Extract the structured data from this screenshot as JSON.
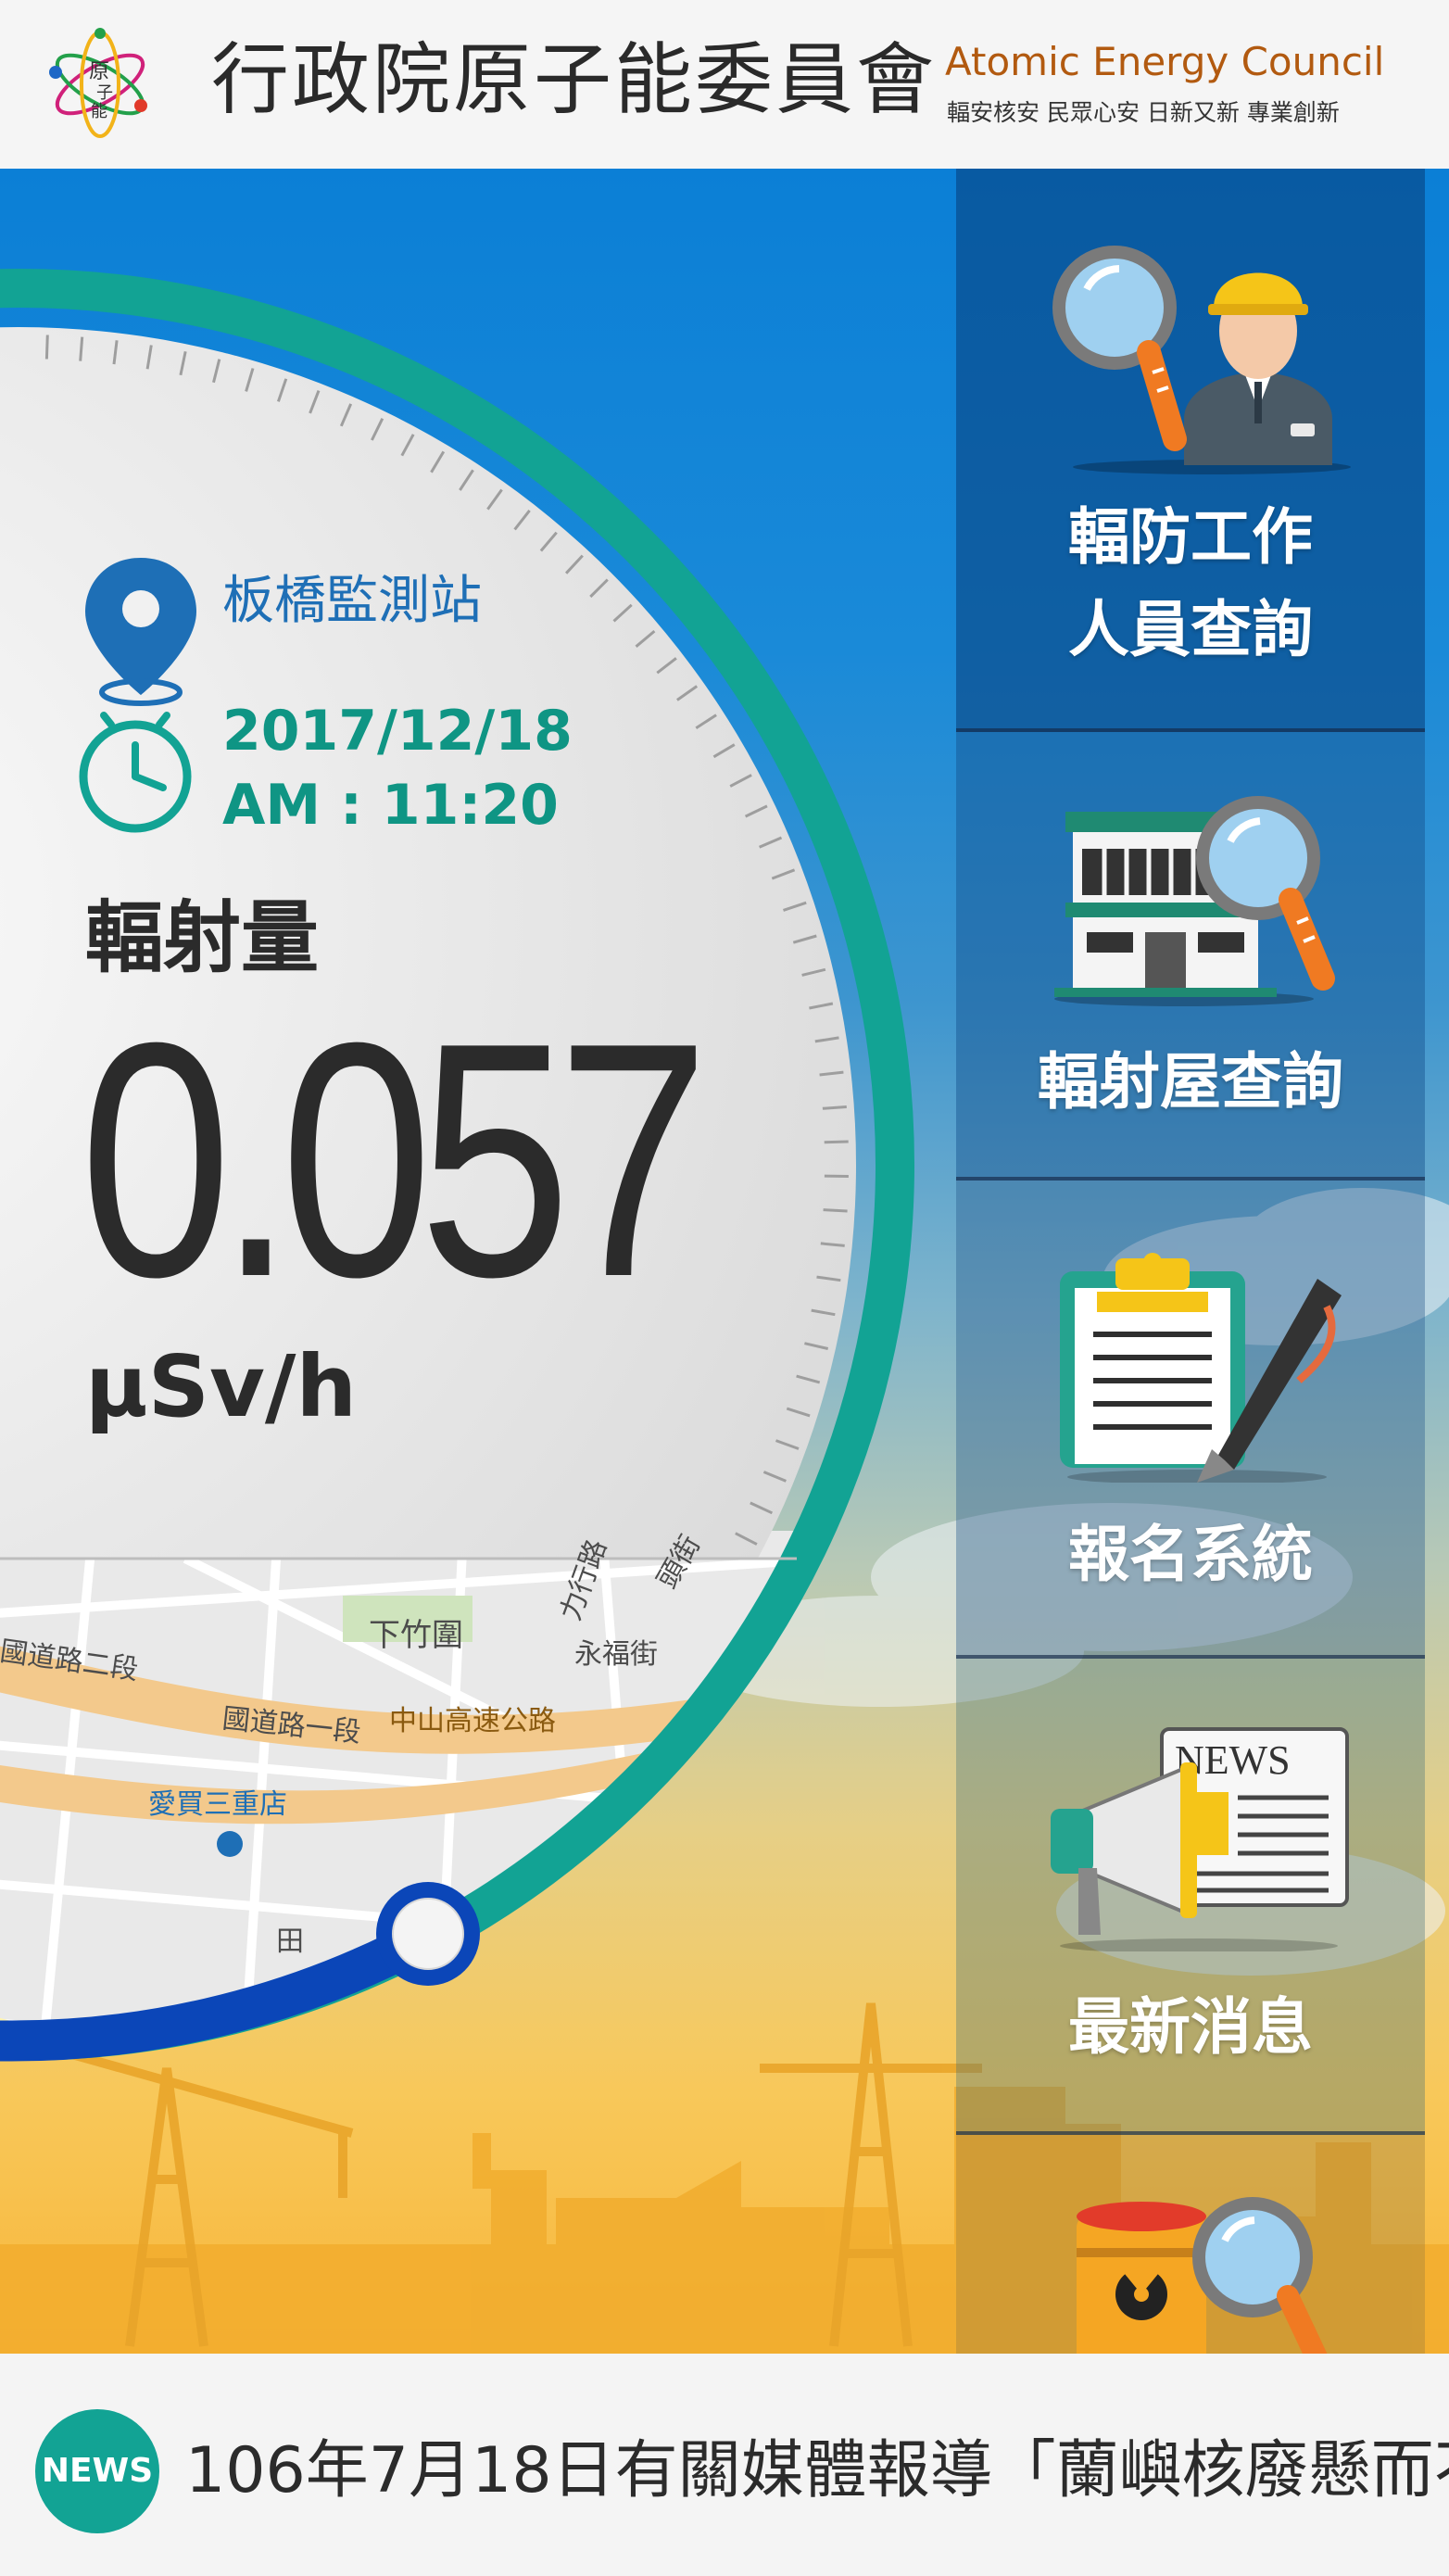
{
  "header": {
    "org_name_zh": "行政院原子能委員會",
    "org_name_en": "Atomic Energy Council",
    "slogan": "輻安核安  民眾心安  日新又新  專業創新",
    "logo_text": "原子能"
  },
  "gauge": {
    "station_name": "板橋監測站",
    "date": "2017/12/18",
    "time": "AM : 11:20",
    "dose_label": "輻射量",
    "dose_value": "0.057",
    "dose_unit": "µSv/h",
    "icons": [
      "location-pin-icon",
      "clock-icon"
    ]
  },
  "map": {
    "labels": [
      "下竹圍",
      "永福街",
      "國道路二段",
      "國道路一段",
      "中山高速公路",
      "愛買三重店",
      "力行路",
      "頭街",
      "田"
    ]
  },
  "menu": {
    "items": [
      {
        "label_line1": "輻防工作",
        "label_line2": "人員查詢",
        "icon": "inspector-magnifier-icon"
      },
      {
        "label_line1": "輻射屋查詢",
        "icon": "house-magnifier-icon"
      },
      {
        "label_line1": "報名系統",
        "icon": "clipboard-pen-icon"
      },
      {
        "label_line1": "最新消息",
        "icon": "news-megaphone-icon",
        "icon_text": "NEWS"
      },
      {
        "label_line1": "",
        "icon": "radioactive-barrel-magnifier-icon"
      }
    ]
  },
  "news": {
    "badge": "NEWS",
    "ticker": "106年7月18日有關媒體報導「蘭嶼核廢懸而不"
  },
  "colors": {
    "teal": "#12a394",
    "blue": "#1e6fb6",
    "ring_blue": "#0b46b8",
    "accent_orange": "#b25a10"
  }
}
